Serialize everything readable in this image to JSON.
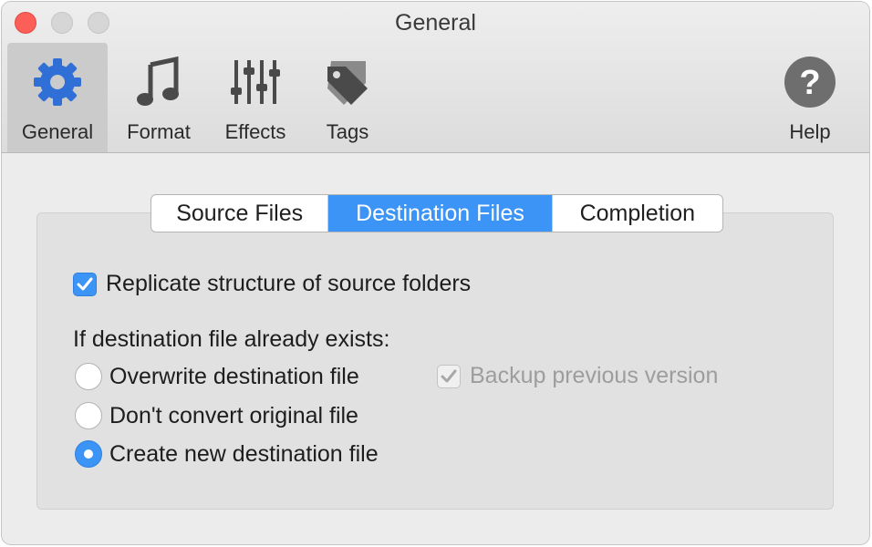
{
  "window": {
    "title": "General"
  },
  "toolbar": {
    "items": [
      {
        "label": "General",
        "icon": "gear-icon",
        "selected": true
      },
      {
        "label": "Format",
        "icon": "music-note-icon"
      },
      {
        "label": "Effects",
        "icon": "sliders-icon"
      },
      {
        "label": "Tags",
        "icon": "tag-icon"
      },
      {
        "label": "Help",
        "icon": "help-icon"
      }
    ]
  },
  "tabs": {
    "items": [
      "Source Files",
      "Destination Files",
      "Completion"
    ],
    "active": "Destination Files"
  },
  "options": {
    "replicate_label": "Replicate structure of source folders",
    "replicate_checked": true,
    "exists_heading": "If destination file already exists:",
    "radios": [
      {
        "label": "Overwrite destination file",
        "checked": false
      },
      {
        "label": "Don't convert original file",
        "checked": false
      },
      {
        "label": "Create new destination file",
        "checked": true
      }
    ],
    "backup_label": "Backup previous version",
    "backup_checked": true,
    "backup_enabled": false
  },
  "colors": {
    "accent": "#3c95f6",
    "close_button": "#fc5f57",
    "toolbar_icon": "#4a4a4a",
    "gear_icon": "#2f6fd6"
  }
}
